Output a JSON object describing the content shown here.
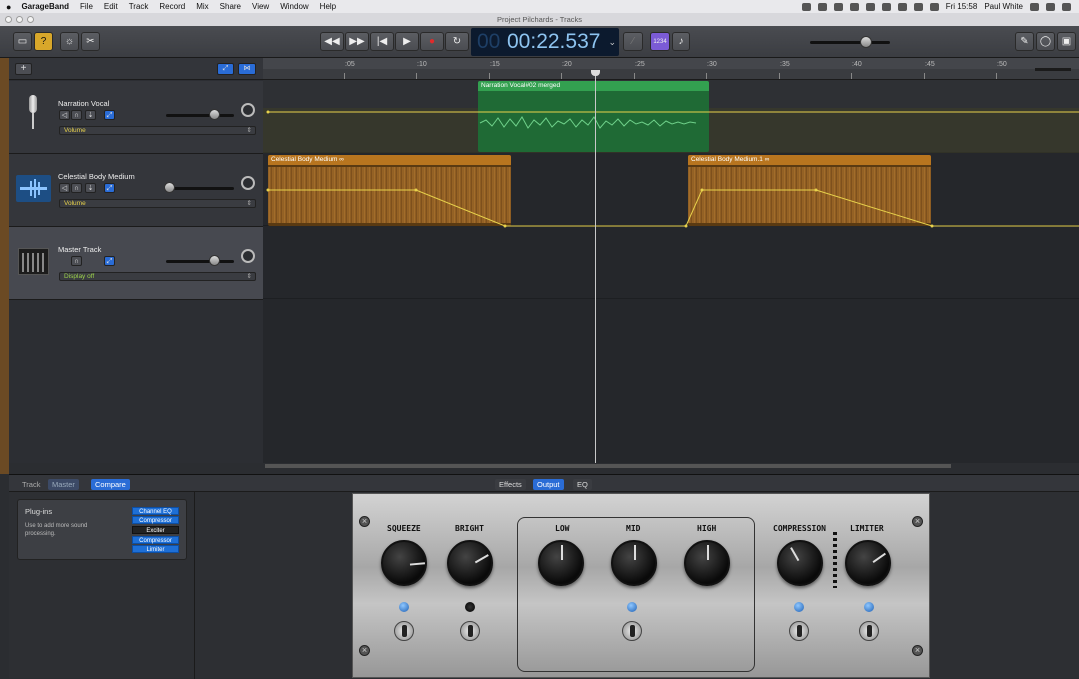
{
  "menubar": {
    "app": "GarageBand",
    "items": [
      "File",
      "Edit",
      "Track",
      "Record",
      "Mix",
      "Share",
      "View",
      "Window",
      "Help"
    ],
    "clock": "Fri 15:58",
    "user": "Paul White"
  },
  "window": {
    "title": "Project Pilchards - Tracks"
  },
  "transport": {
    "time": "00:22.537",
    "time_prefix": "00",
    "count_in": "1234"
  },
  "ruler": {
    "labels": [
      ":05",
      ":10",
      ":15",
      ":20",
      ":25",
      ":30",
      ":35",
      ":40",
      ":45",
      ":50"
    ]
  },
  "tracks": [
    {
      "name": "Narration Vocal",
      "automation": "Volume"
    },
    {
      "name": "Celestial Body Medium",
      "automation": "Volume"
    },
    {
      "name": "Master Track",
      "automation": "Display off"
    }
  ],
  "regions": {
    "narration": "Narration Vocal#02 merged",
    "celestial1": "Celestial Body Medium",
    "celestial2": "Celestial Body Medium.1"
  },
  "bottom": {
    "tabs_left": [
      "Track",
      "Master",
      "Compare"
    ],
    "tabs_center": [
      "Effects",
      "Output",
      "EQ"
    ],
    "plugins_title": "Plug-ins",
    "plugins_hint": "Use to add more sound processing.",
    "plugins": [
      "Channel EQ",
      "Compressor",
      "Exciter",
      "Compressor",
      "Limiter"
    ]
  },
  "amp": {
    "knobs": [
      "SQUEEZE",
      "BRIGHT",
      "LOW",
      "MID",
      "HIGH",
      "COMPRESSION",
      "LIMITER"
    ]
  },
  "colors": {
    "accent": "#2a6cd6",
    "audio_region": "#b8751f",
    "voice_region": "#2f9a49",
    "automation": "#e8d24c"
  }
}
